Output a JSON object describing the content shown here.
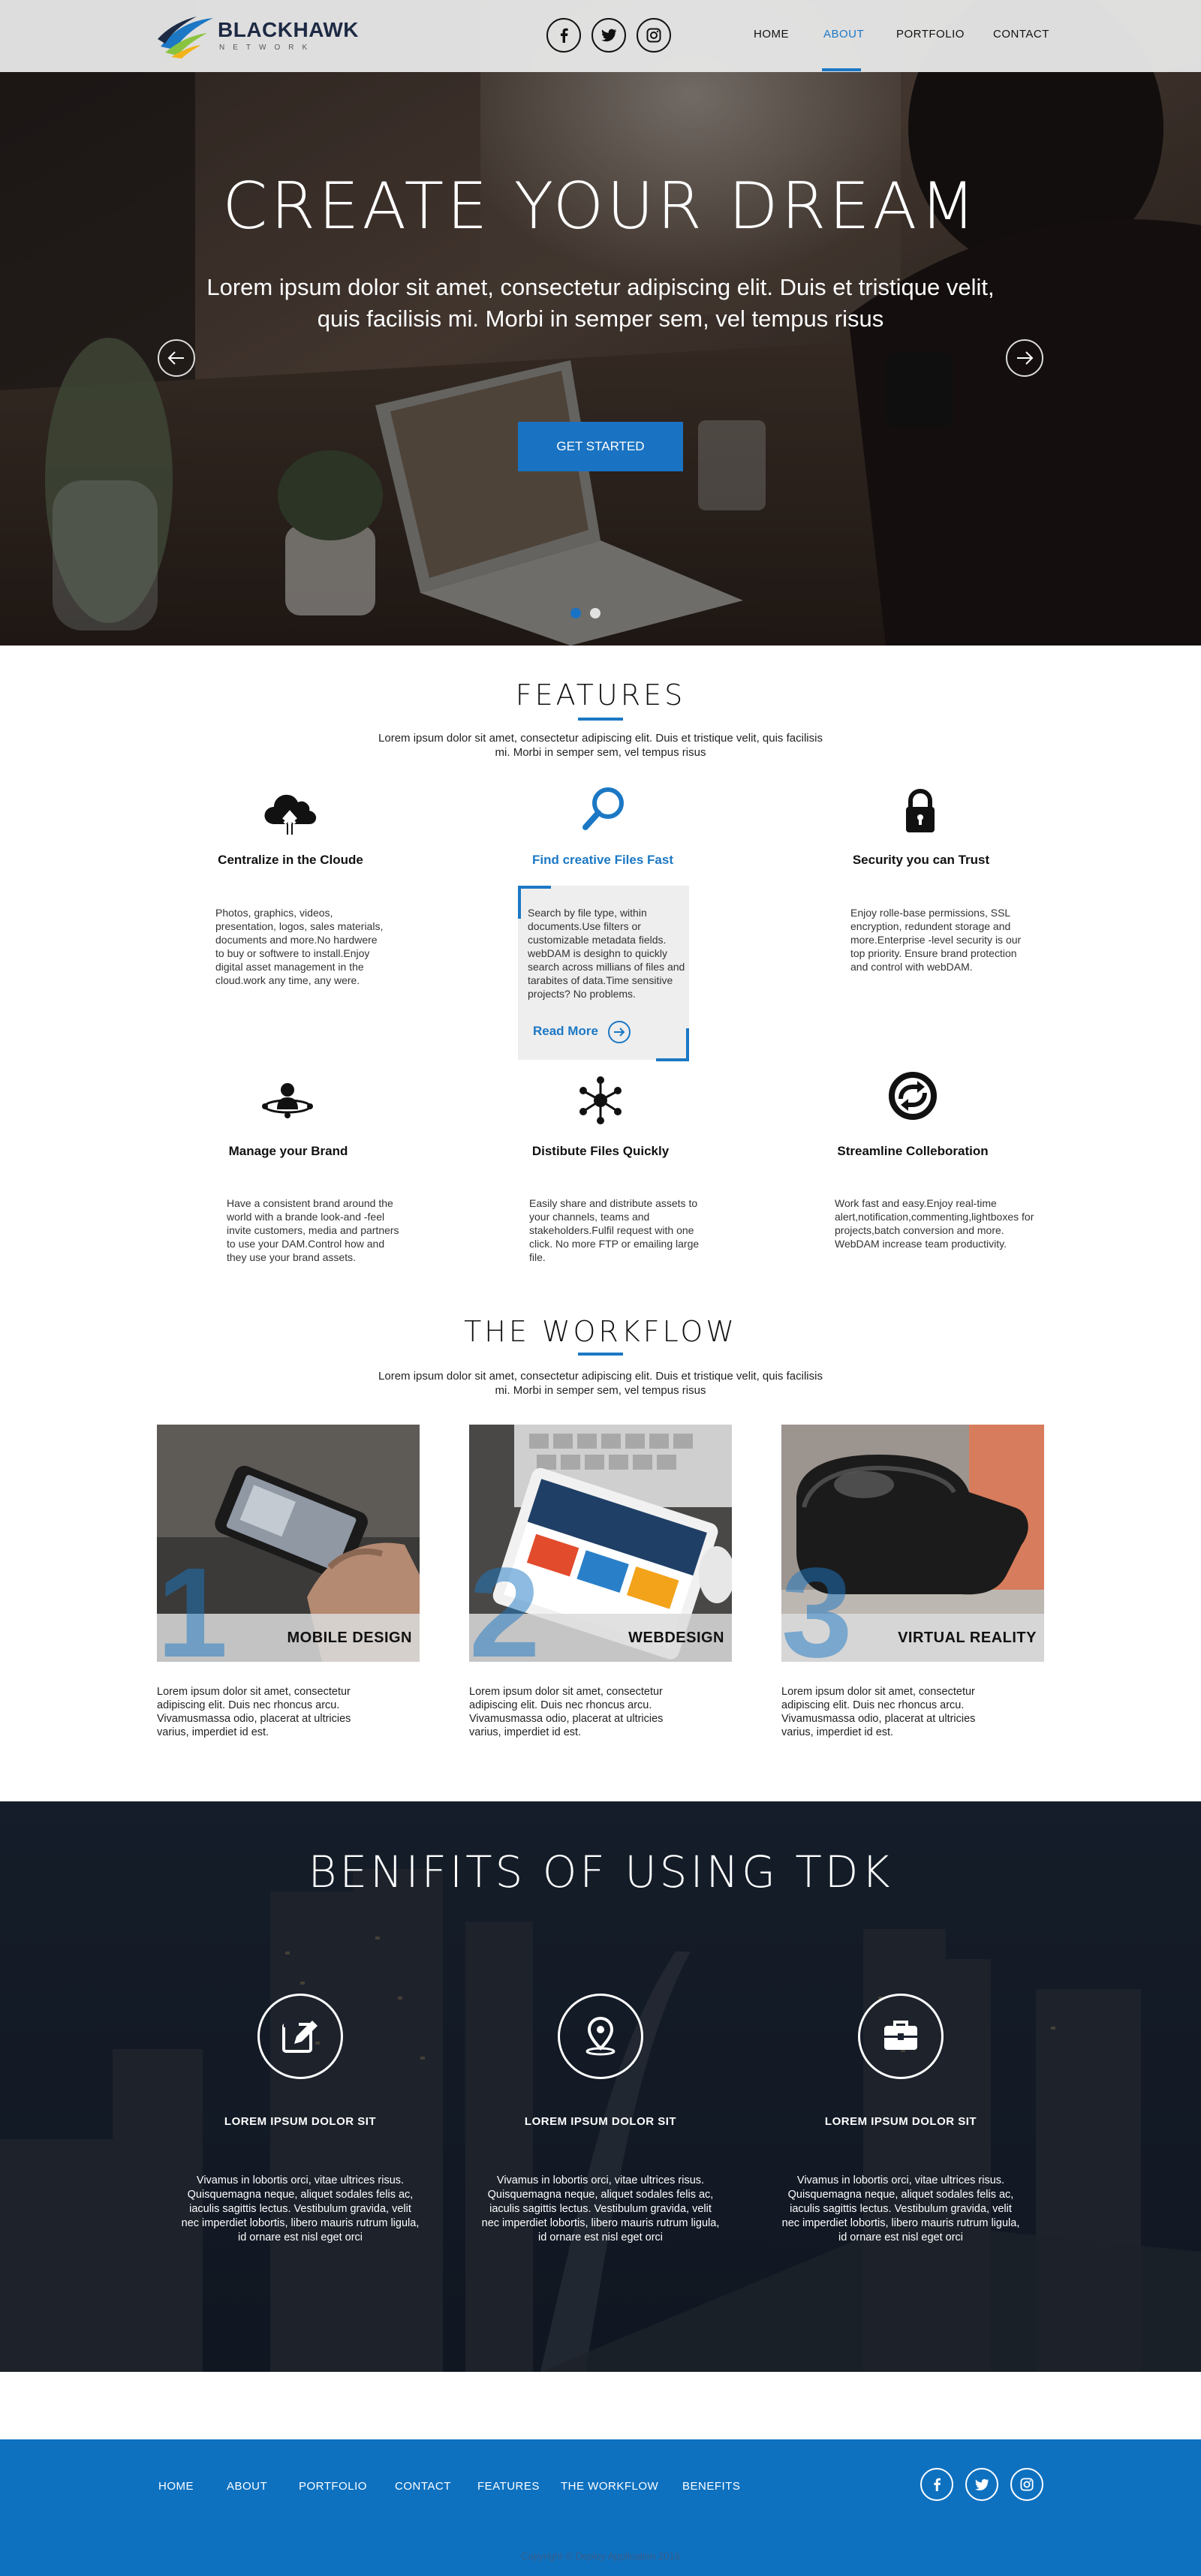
{
  "colors": {
    "accent": "#1c78c4",
    "footer_bg": "#0e71c0",
    "benefits_bg": "#1a2230"
  },
  "header": {
    "logo_title": "BLACKHAWK",
    "logo_subtitle": "NETWORK",
    "social_icons": [
      "facebook-icon",
      "twitter-icon",
      "instagram-icon"
    ],
    "nav": [
      "HOME",
      "ABOUT",
      "PORTFOLIO",
      "CONTACT"
    ],
    "active_nav": "ABOUT"
  },
  "hero": {
    "title": "CREATE YOUR DREAM",
    "subtitle": "Lorem ipsum dolor sit amet, consectetur adipiscing elit. Duis et tristique velit, quis facilisis mi. Morbi in semper sem, vel tempus risus",
    "cta": "GET STARTED",
    "slide_count": 2,
    "active_slide": 1
  },
  "features": {
    "title": "FEATURES",
    "description": "Lorem ipsum dolor sit amet, consectetur adipiscing elit. Duis et tristique velit, quis facilisis mi. Morbi in semper sem, vel tempus risus",
    "read_more": "Read More",
    "items": [
      {
        "icon": "cloud-upload-icon",
        "title": "Centralize in the Cloude",
        "text": "Photos, graphics, videos, presentation, logos, sales materials, documents and more.No hardwere to buy or softwere to install.Enjoy digital asset management in the cloud.work any time, any were."
      },
      {
        "icon": "search-icon",
        "title": "Find creative Files Fast",
        "text": "Search by file type, within documents.Use filters or customizable metadata fields. webDAM is desighn to quickly search across millians of files and tarabites of data.Time sensitive projects? No problems."
      },
      {
        "icon": "lock-icon",
        "title": "Security you can Trust",
        "text": "Enjoy rolle-base permissions, SSL encryption, redundent storage and more.Enterprise -level security is our top priority. Ensure brand protection and control with webDAM."
      },
      {
        "icon": "brand-user-icon",
        "title": "Manage your Brand",
        "text": "Have a consistent brand around the world with a brande look-and -feel invite customers, media and partners to use your DAM.Control how and they use your brand assets."
      },
      {
        "icon": "network-icon",
        "title": "Distibute Files Quickly",
        "text": "Easily share and distribute assets to your channels, teams and stakeholders.Fulfil request with one click. No more FTP or emailing large file."
      },
      {
        "icon": "sync-icon",
        "title": "Streamline Colleboration",
        "text": "Work fast and easy.Enjoy real-time alert,notification,commenting,lightboxes for projects,batch conversion and more. WebDAM increase team productivity."
      }
    ]
  },
  "workflow": {
    "title": "THE WORKFLOW",
    "description": "Lorem ipsum dolor sit amet, consectetur adipiscing elit. Duis et tristique velit, quis facilisis mi. Morbi in semper sem, vel tempus risus",
    "cards": [
      {
        "number": "1",
        "label": "MOBILE DESIGN",
        "text": "Lorem ipsum dolor sit amet, consectetur adipiscing elit. Duis nec rhoncus arcu. Vivamusmassa odio, placerat at ultricies varius, imperdiet id est."
      },
      {
        "number": "2",
        "label": "WEBDESIGN",
        "text": "Lorem ipsum dolor sit amet, consectetur adipiscing elit. Duis nec rhoncus arcu. Vivamusmassa odio, placerat at ultricies varius, imperdiet id est."
      },
      {
        "number": "3",
        "label": "VIRTUAL REALITY",
        "text": "Lorem ipsum dolor sit amet, consectetur adipiscing elit. Duis nec rhoncus arcu. Vivamusmassa odio, placerat at ultricies varius, imperdiet id est."
      }
    ]
  },
  "benefits": {
    "title": "BENIFITS OF USING TDK",
    "items": [
      {
        "icon": "edit-icon",
        "heading": "LOREM IPSUM DOLOR SIT",
        "text": "Vivamus in lobortis orci, vitae ultrices risus. Quisquemagna neque, aliquet sodales felis ac, iaculis sagittis lectus. Vestibulum gravida, velit nec imperdiet lobortis, libero mauris rutrum ligula, id ornare est nisl eget orci"
      },
      {
        "icon": "location-pin-icon",
        "heading": "LOREM IPSUM DOLOR SIT",
        "text": "Vivamus in lobortis orci, vitae ultrices risus. Quisquemagna neque, aliquet sodales felis ac, iaculis sagittis lectus. Vestibulum gravida, velit nec imperdiet lobortis, libero mauris rutrum ligula, id ornare est nisl eget orci"
      },
      {
        "icon": "briefcase-icon",
        "heading": "LOREM IPSUM DOLOR SIT",
        "text": "Vivamus in lobortis orci, vitae ultrices risus. Quisquemagna neque, aliquet sodales felis ac, iaculis sagittis lectus. Vestibulum gravida, velit nec imperdiet lobortis, libero mauris rutrum ligula, id ornare est nisl eget orci"
      }
    ]
  },
  "footer": {
    "links": [
      "HOME",
      "ABOUT",
      "PORTFOLIO",
      "CONTACT",
      "FEATURES",
      "THE WORKFLOW",
      "BENEFITS"
    ],
    "social_icons": [
      "facebook-icon",
      "twitter-icon",
      "instagram-icon"
    ],
    "copyright": "Copyright © Deploy Application 2016"
  }
}
